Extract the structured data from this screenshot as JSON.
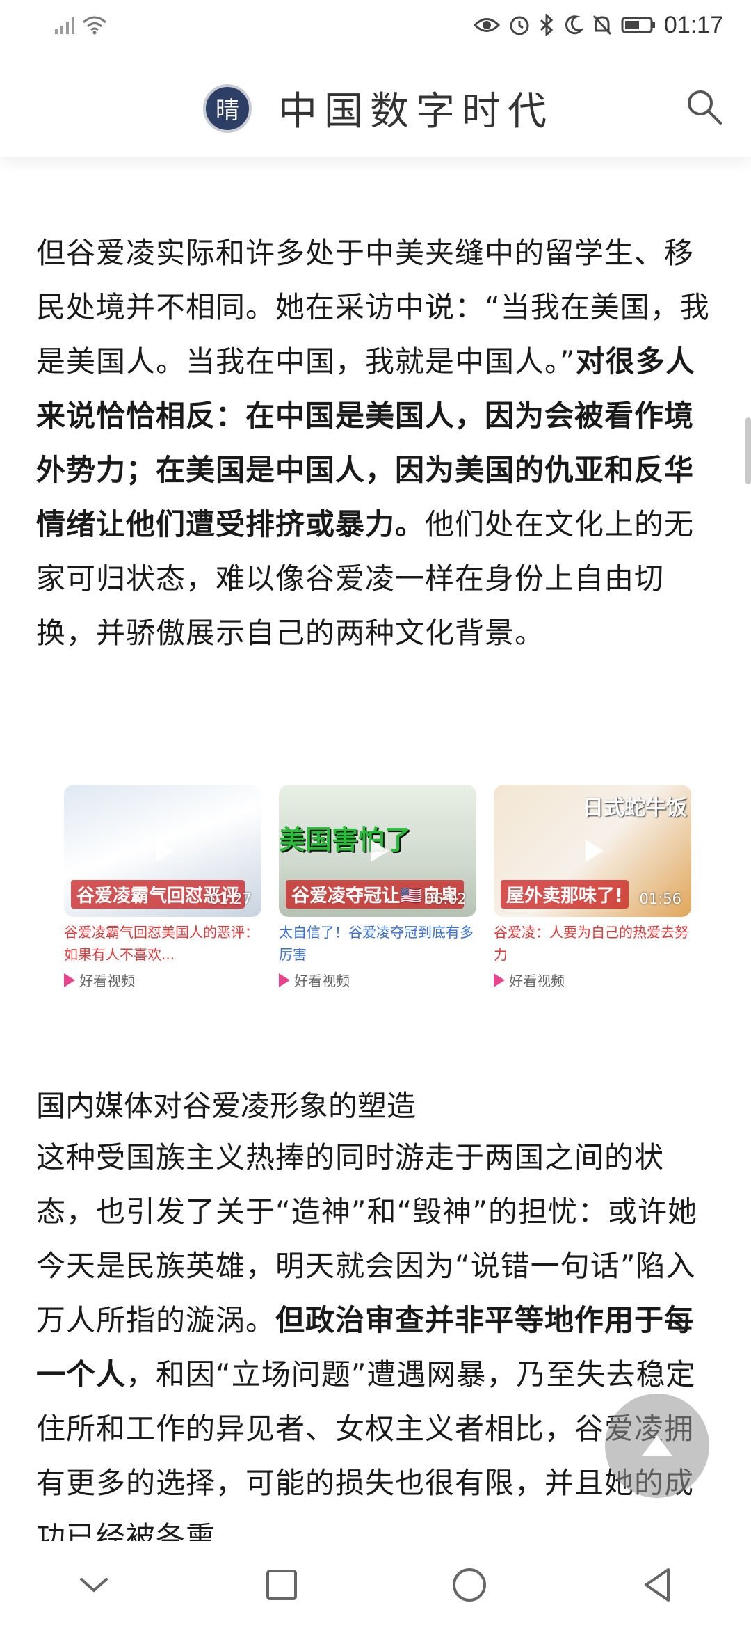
{
  "status_bar": {
    "time": "01:17",
    "icons": [
      "signal-icon",
      "wifi-icon",
      "eye-icon",
      "alarm-icon",
      "bluetooth-icon",
      "moon-icon",
      "bell-off-icon",
      "battery-icon"
    ]
  },
  "header": {
    "logo_text": "晴",
    "title": "中国数字时代",
    "search_icon": "search-icon"
  },
  "article": {
    "para1": {
      "normal_1": "但谷爱凌实际和许多处于中美夹缝中的留学生、移民处境并不相同。她在采访中说：“当我在美国，我是美国人。当我在中国，我就是中国人。”",
      "bold_1": "对很多人来说恰恰相反：在中国是美国人，因为会被看作境外势力；在美国是中国人，因为美国的仇亚和反华情绪让他们遭受排挤或暴力。",
      "normal_2": "他们处在文化上的无家可归状态，难以像谷爱凌一样在身份上自由切换，并骄傲展示自己的两种文化背景。"
    },
    "subheading": "国内媒体对谷爱凌形象的塑造",
    "para2": {
      "normal_1": "这种受国族主义热捧的同时游走于两国之间的状态，也引发了关于“造神”和“毁神”的担忧：或许她今天是民族英雄，明天就会因为“说错一句话”陷入万人所指的漩涡。",
      "bold_1": "但政治审查并非平等地作用于每一个人",
      "normal_2": "，和因“立场问题”遭遇网暴，乃至失去稳定住所和工作的异见者、女权主义者相比，谷爱凌拥有更多的选择，可能的损失也很有限，并且她的成功已经被各熏"
    }
  },
  "videos": [
    {
      "thumb_caption": "谷爱凌霸气回怼恶评",
      "duration": "01:27",
      "title": "谷爱凌霸气回怼美国人的恶评：如果有人不喜欢...",
      "source": "好看视频"
    },
    {
      "thumb_banner": "美国害怕了",
      "thumb_caption": "谷爱凌夺冠让🇺🇸自卑",
      "duration": "06:02",
      "title": "太自信了！谷爱凌夺冠到底有多厉害",
      "source": "好看视频"
    },
    {
      "thumb_banner": "日式蛇牛饭",
      "thumb_caption": "屋外卖那味了!",
      "duration": "01:56",
      "title": "谷爱凌：人要为自己的热爱去努力",
      "source": "好看视频"
    }
  ],
  "nav_bar": {
    "icons": [
      "chevron-down-icon",
      "recent-apps-icon",
      "home-icon",
      "back-icon"
    ]
  },
  "colors": {
    "red_title": "#e23a3a",
    "blue_title": "#3a6fd8",
    "logo_bg": "#2e3f66"
  }
}
